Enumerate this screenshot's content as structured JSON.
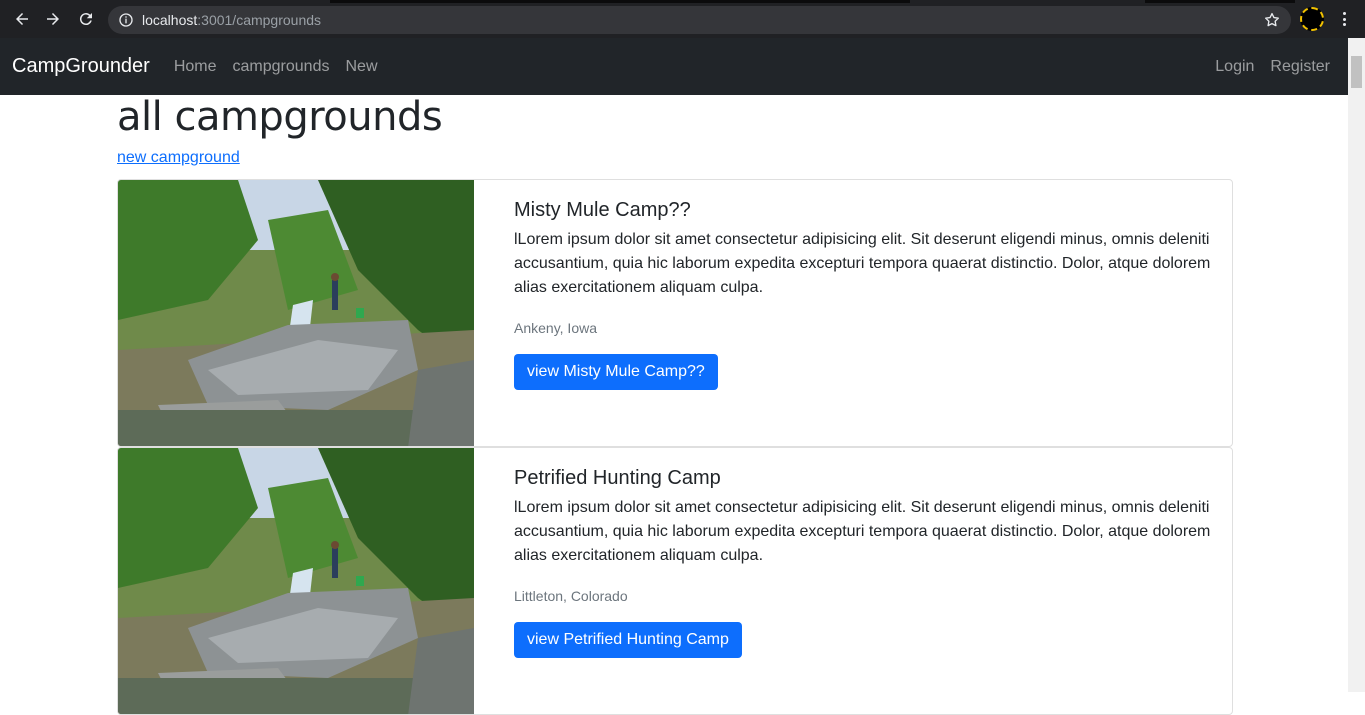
{
  "browser": {
    "url_host": "localhost",
    "url_rest": ":3001/campgrounds"
  },
  "navbar": {
    "brand": "CampGrounder",
    "links": [
      "Home",
      "campgrounds",
      "New"
    ],
    "right_links": [
      "Login",
      "Register"
    ]
  },
  "page": {
    "title": "all campgrounds",
    "new_link": "new campground"
  },
  "campgrounds": [
    {
      "title": "Misty Mule Camp??",
      "description": "lLorem ipsum dolor sit amet consectetur adipisicing elit. Sit deserunt eligendi minus, omnis deleniti accusantium, quia hic laborum expedita excepturi tempora quaerat distinctio. Dolor, atque dolorem alias exercitationem aliquam culpa.",
      "location": "Ankeny, Iowa",
      "button": "view Misty Mule Camp??"
    },
    {
      "title": "Petrified Hunting Camp",
      "description": "lLorem ipsum dolor sit amet consectetur adipisicing elit. Sit deserunt eligendi minus, omnis deleniti accusantium, quia hic laborum expedita excepturi tempora quaerat distinctio. Dolor, atque dolorem alias exercitationem aliquam culpa.",
      "location": "Littleton, Colorado",
      "button": "view Petrified Hunting Camp"
    }
  ],
  "colors": {
    "navbar_bg": "#212529",
    "primary": "#0d6efd",
    "chrome_bg": "#202124"
  }
}
